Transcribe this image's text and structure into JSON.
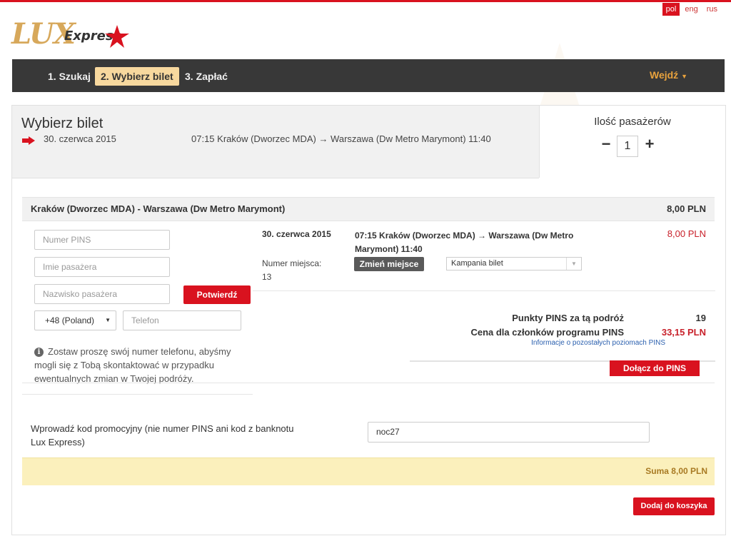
{
  "languages": [
    {
      "code": "pol",
      "active": true
    },
    {
      "code": "eng",
      "active": false
    },
    {
      "code": "rus",
      "active": false
    }
  ],
  "logo": {
    "word1": "LUX",
    "word2": "Express"
  },
  "nav": {
    "steps": [
      "1. Szukaj",
      "2. Wybierz bilet",
      "3. Zapłać"
    ],
    "active_step": 1,
    "login": "Wejdź"
  },
  "header": {
    "title": "Wybierz bilet",
    "date": "30. czerwca 2015",
    "route": "07:15 Kraków (Dworzec MDA) → Warszawa (Dw Metro Marymont) 11:40"
  },
  "passengers": {
    "label": "Ilość pasażerów",
    "count": "1",
    "minus": "−",
    "plus": "+"
  },
  "trip": {
    "route_title": "Kraków (Dworzec MDA) - Warszawa (Dw Metro Marymont)",
    "route_price": "8,00 PLN",
    "date": "30. czerwca 2015",
    "route": "07:15 Kraków (Dworzec MDA) → Warszawa (Dw Metro Marymont) 11:40",
    "price": "8,00 PLN",
    "seat_label": "Numer miejsca: 13",
    "change_seat": "Zmień miejsce",
    "ticket_type": "Kampania bilet"
  },
  "form": {
    "pins_placeholder": "Numer PINS",
    "name_placeholder": "Imie pasażera",
    "surname_placeholder": "Nazwisko pasażera",
    "confirm": "Potwierdź",
    "country_code": "+48 (Poland)",
    "phone_placeholder": "Telefon",
    "info": "Zostaw proszę swój numer telefonu, abyśmy mogli się z Tobą skontaktować w przypadku ewentualnych zmian w Twojej podróży."
  },
  "pins": {
    "points_label": "Punkty PINS za tą podróż",
    "points_value": "19",
    "member_price_label": "Cena dla członków programu PINS",
    "member_price_value": "33,15 PLN",
    "info_link": "Informacje o pozostałych poziomach PINS",
    "join": "Dołącz do PINS"
  },
  "promo": {
    "label": "Wprowadź kod promocyjny (nie numer PINS ani kod z banknotu Lux Express)",
    "value": "noc27"
  },
  "summary": {
    "total": "Suma 8,00 PLN",
    "add_to_cart": "Dodaj do koszyka"
  },
  "colors": {
    "brand_red": "#d9121f",
    "nav_bg": "#383838",
    "active_step_bg": "#f7d89e",
    "login": "#e8a23d",
    "sum_bar": "#fbf0bc"
  }
}
